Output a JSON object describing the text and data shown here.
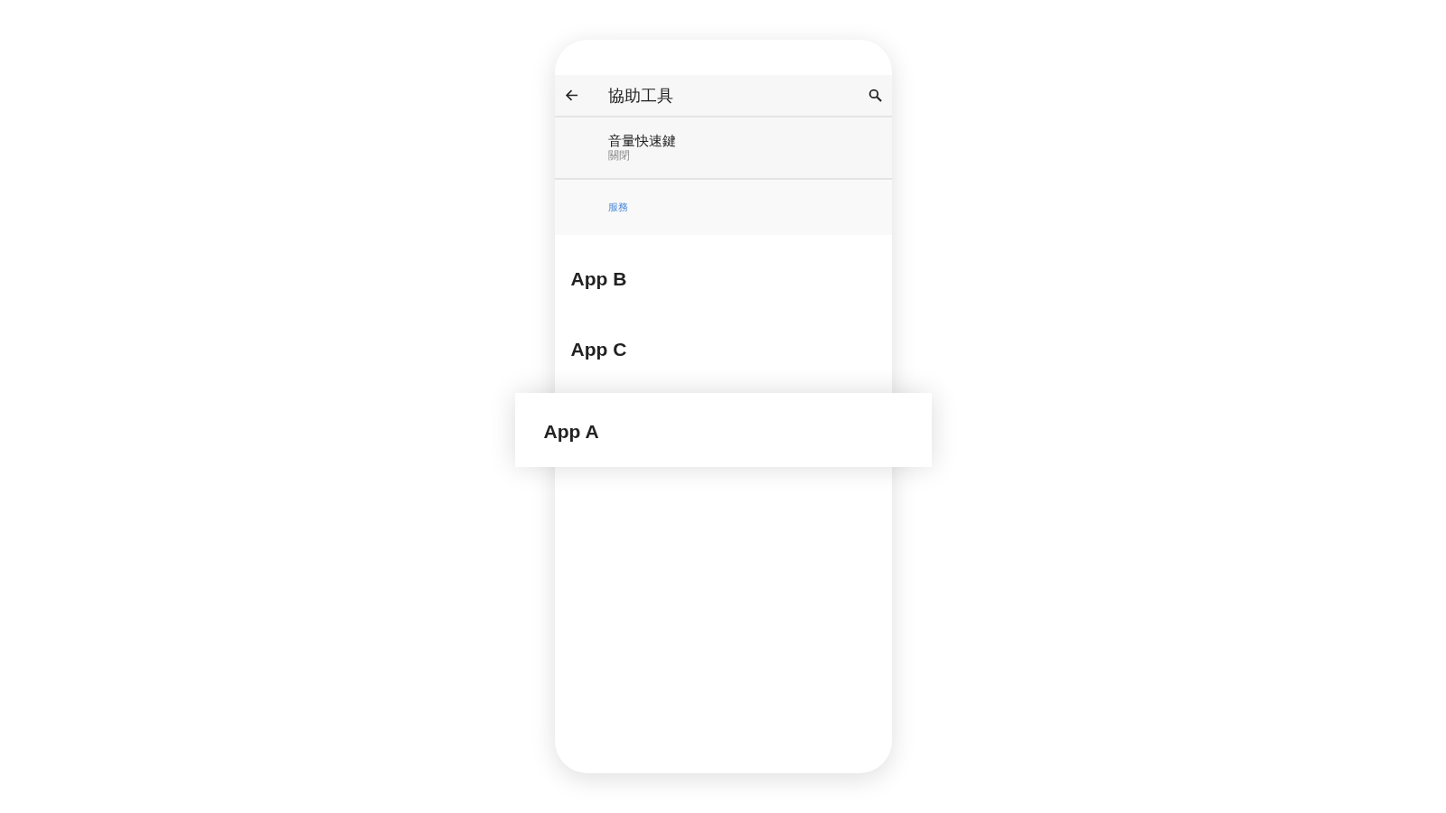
{
  "app_bar": {
    "title": "協助工具"
  },
  "setting": {
    "title": "音量快速鍵",
    "value": "關閉"
  },
  "section": {
    "title": "服務"
  },
  "apps": [
    {
      "label": "App B"
    },
    {
      "label": "App C"
    }
  ],
  "dragged_item": {
    "label": "App A"
  }
}
